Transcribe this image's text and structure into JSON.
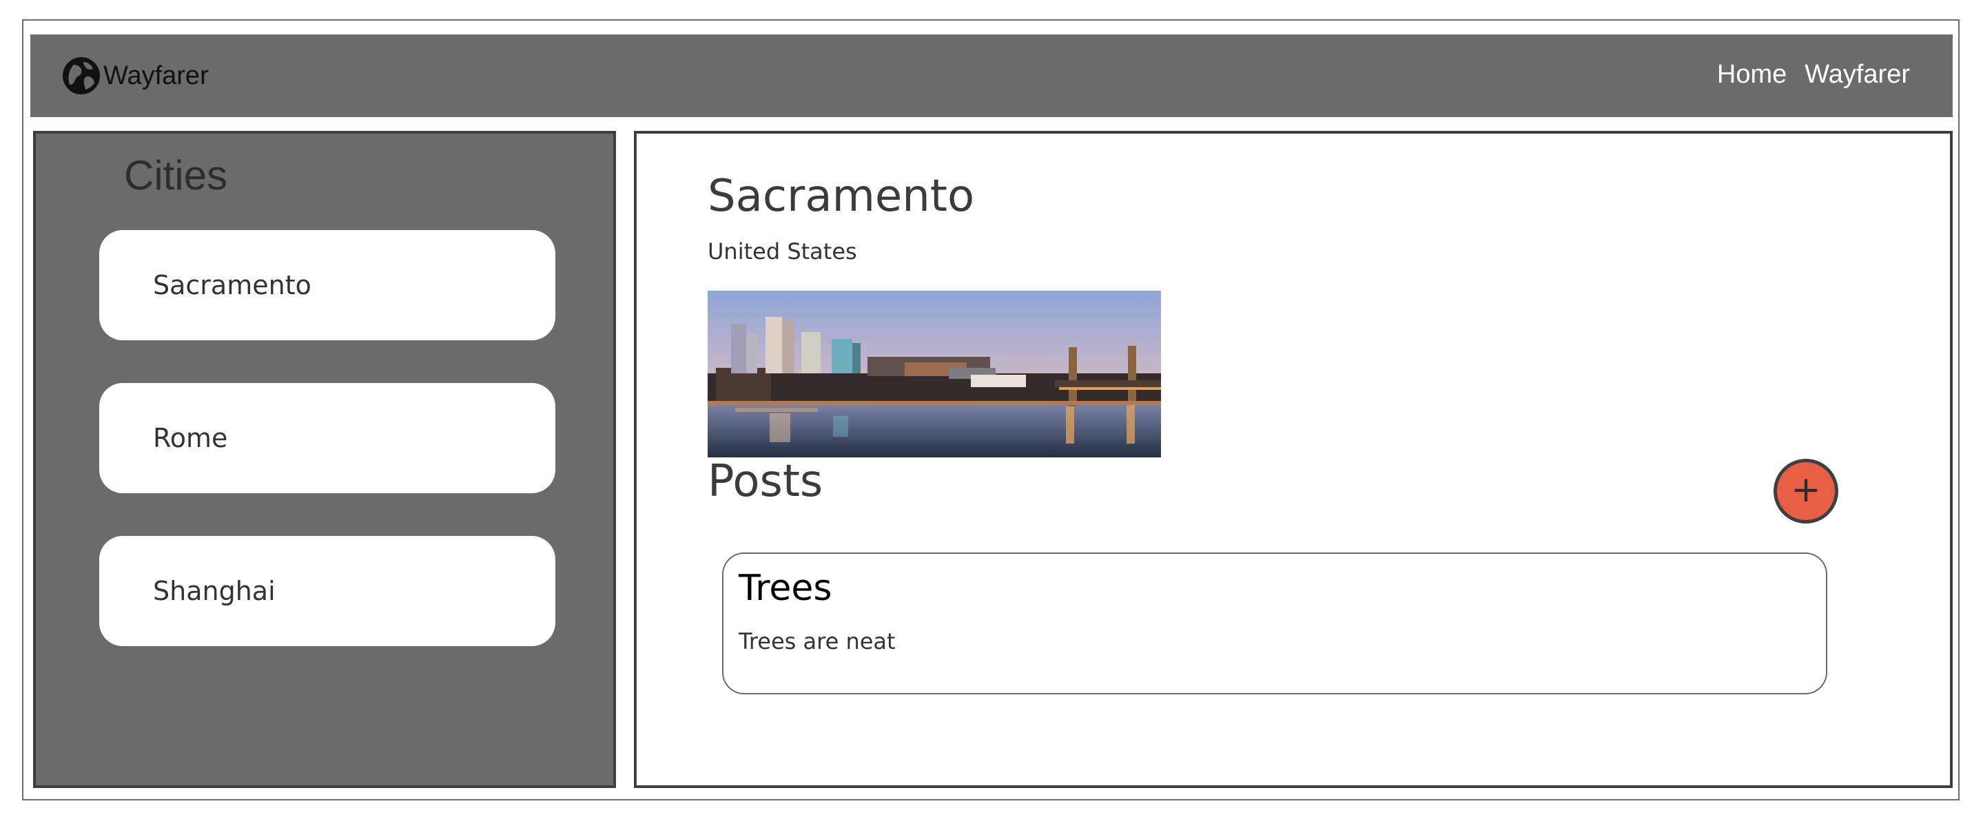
{
  "navbar": {
    "brand_label": "Wayfarer",
    "brand_icon": "globe-icon",
    "links": [
      "Home",
      "Wayfarer"
    ],
    "background": "#6b6b6b"
  },
  "sidebar": {
    "title": "Cities",
    "cities": [
      "Sacramento",
      "Rome",
      "Shanghai"
    ]
  },
  "city": {
    "name": "Sacramento",
    "country": "United States"
  },
  "posts": {
    "heading": "Posts",
    "add_icon": "+",
    "items": [
      {
        "title": "Trees",
        "body": "Trees are neat"
      }
    ]
  },
  "colors": {
    "accent": "#e85f46",
    "panel": "#6b6b6b",
    "border": "#3f3f3f"
  }
}
